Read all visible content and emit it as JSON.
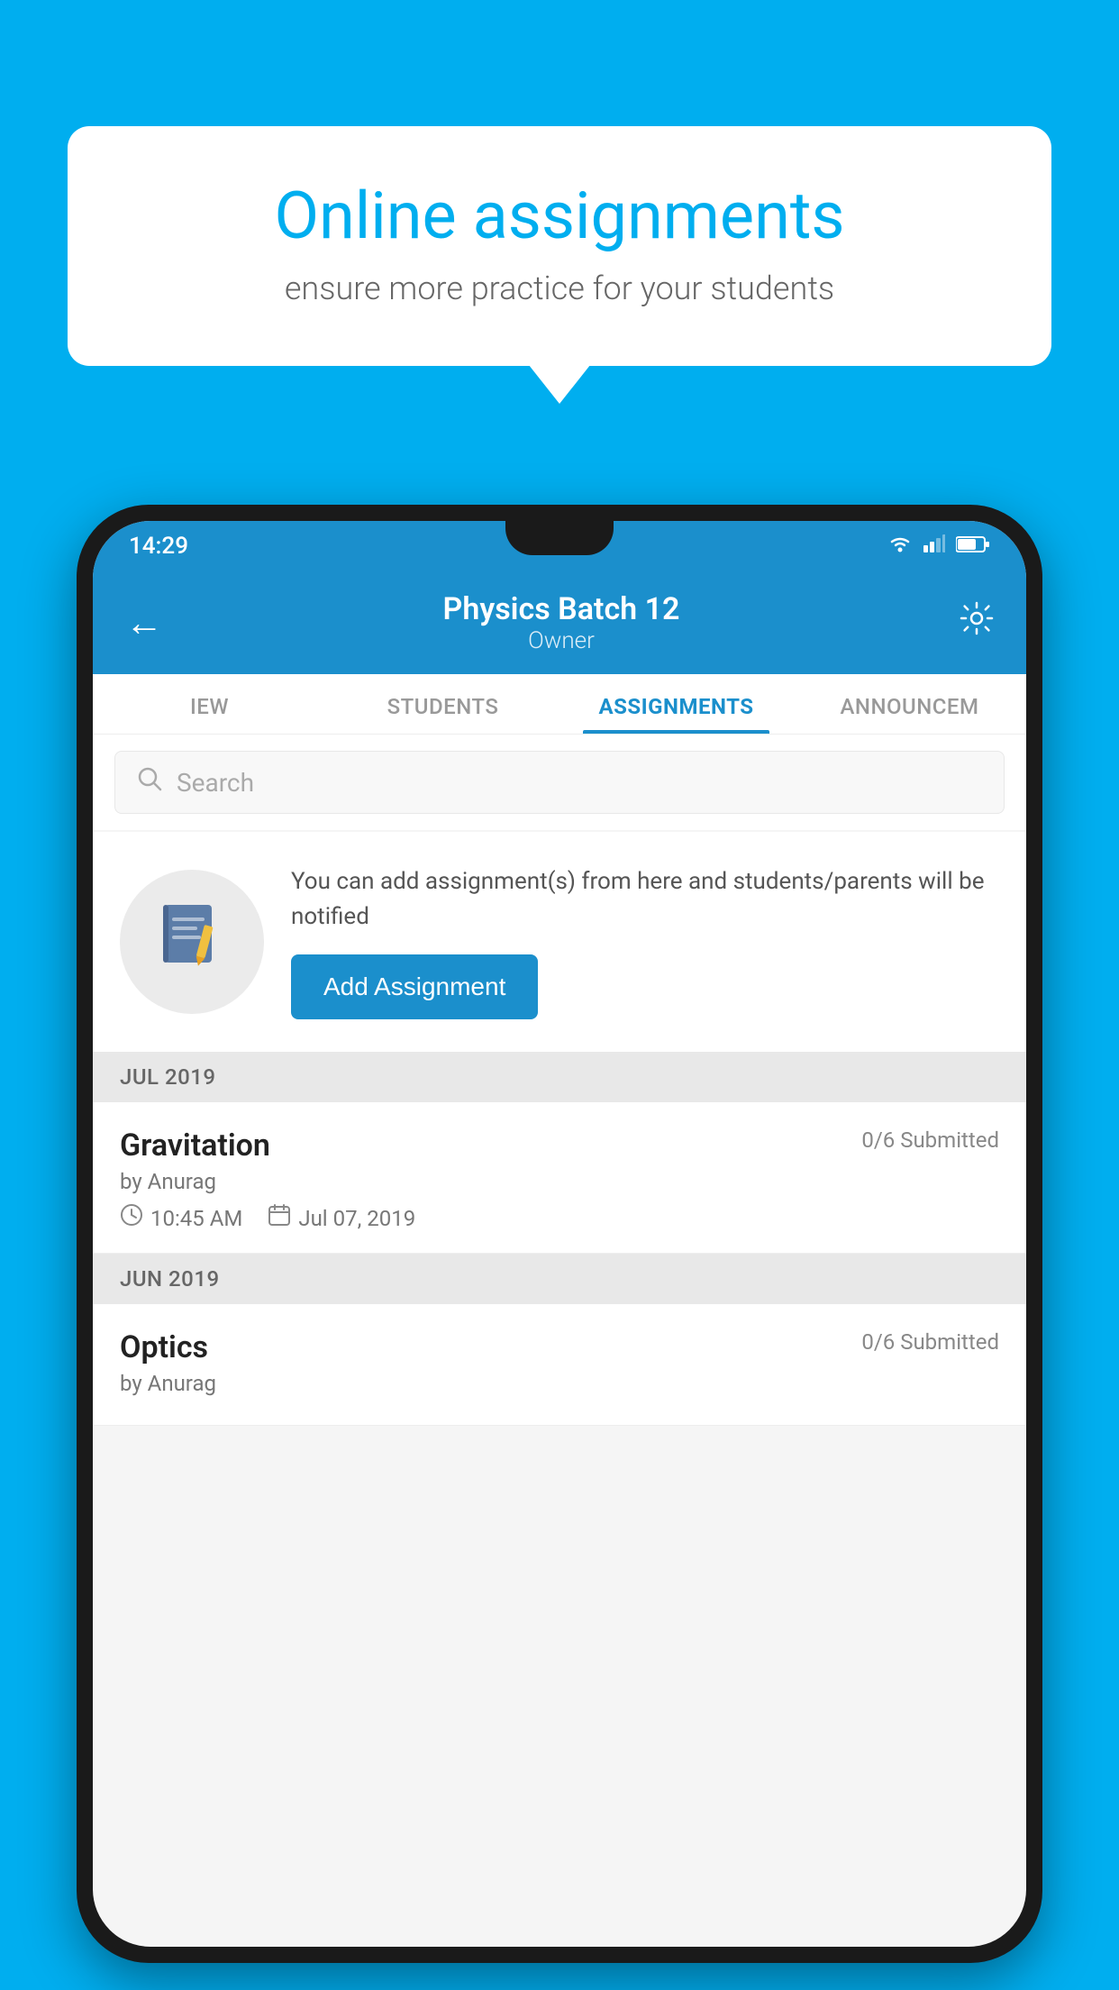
{
  "background_color": "#00AEEF",
  "speech_bubble": {
    "title": "Online assignments",
    "subtitle": "ensure more practice for your students"
  },
  "status_bar": {
    "time": "14:29",
    "wifi": "▲",
    "signal": "▲",
    "battery": "▮"
  },
  "app_header": {
    "title": "Physics Batch 12",
    "subtitle": "Owner",
    "back_label": "←",
    "settings_label": "⚙"
  },
  "tabs": [
    {
      "label": "IEW",
      "active": false
    },
    {
      "label": "STUDENTS",
      "active": false
    },
    {
      "label": "ASSIGNMENTS",
      "active": true
    },
    {
      "label": "ANNOUNCEM",
      "active": false
    }
  ],
  "search": {
    "placeholder": "Search"
  },
  "add_assignment_section": {
    "description": "You can add assignment(s) from here and students/parents will be notified",
    "button_label": "Add Assignment"
  },
  "sections": [
    {
      "header": "JUL 2019",
      "items": [
        {
          "name": "Gravitation",
          "submitted": "0/6 Submitted",
          "by": "by Anurag",
          "time": "10:45 AM",
          "date": "Jul 07, 2019"
        }
      ]
    },
    {
      "header": "JUN 2019",
      "items": [
        {
          "name": "Optics",
          "submitted": "0/6 Submitted",
          "by": "by Anurag",
          "time": "",
          "date": ""
        }
      ]
    }
  ]
}
